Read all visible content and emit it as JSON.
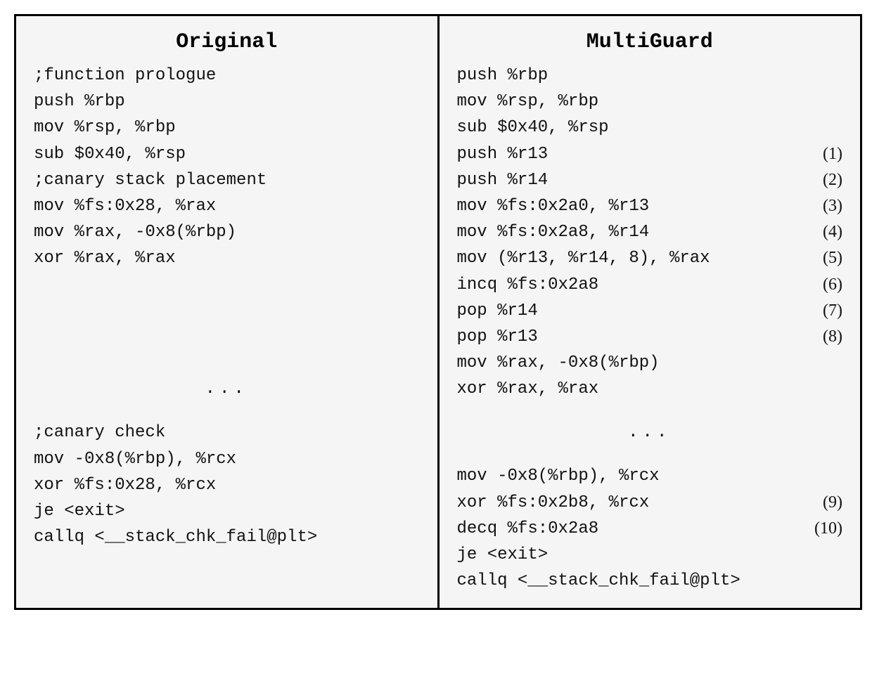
{
  "left": {
    "title": "Original",
    "lines": [
      {
        "text": ";function prologue"
      },
      {
        "text": "push %rbp"
      },
      {
        "text": "mov %rsp, %rbp"
      },
      {
        "text": "sub $0x40, %rsp"
      },
      {
        "text": ";canary stack placement"
      },
      {
        "text": "mov %fs:0x28, %rax"
      },
      {
        "text": "mov %rax, -0x8(%rbp)"
      },
      {
        "text": "xor %rax, %rax"
      }
    ],
    "ellipsis": "...",
    "lines2": [
      {
        "text": ";canary check"
      },
      {
        "text": "mov -0x8(%rbp), %rcx"
      },
      {
        "text": "xor %fs:0x28, %rcx"
      },
      {
        "text": "je <exit>"
      },
      {
        "text": "callq <__stack_chk_fail@plt>"
      }
    ]
  },
  "right": {
    "title": "MultiGuard",
    "lines": [
      {
        "text": "push %rbp"
      },
      {
        "text": "mov %rsp, %rbp"
      },
      {
        "text": "sub $0x40, %rsp"
      },
      {
        "text": "push %r13",
        "num": "(1)"
      },
      {
        "text": "push %r14",
        "num": "(2)"
      },
      {
        "text": "mov %fs:0x2a0, %r13",
        "num": "(3)"
      },
      {
        "text": "mov %fs:0x2a8, %r14",
        "num": "(4)"
      },
      {
        "text": "mov (%r13, %r14, 8), %rax",
        "num": "(5)"
      },
      {
        "text": "incq %fs:0x2a8",
        "num": "(6)"
      },
      {
        "text": "pop %r14",
        "num": "(7)"
      },
      {
        "text": "pop %r13",
        "num": "(8)"
      },
      {
        "text": "mov %rax, -0x8(%rbp)"
      },
      {
        "text": "xor %rax, %rax"
      }
    ],
    "ellipsis": "...",
    "lines2": [
      {
        "text": "mov -0x8(%rbp), %rcx"
      },
      {
        "text": "xor %fs:0x2b8, %rcx",
        "num": "(9)"
      },
      {
        "text": "decq %fs:0x2a8",
        "num": "(10)"
      },
      {
        "text": "je <exit>"
      },
      {
        "text": "callq <__stack_chk_fail@plt>"
      }
    ]
  }
}
